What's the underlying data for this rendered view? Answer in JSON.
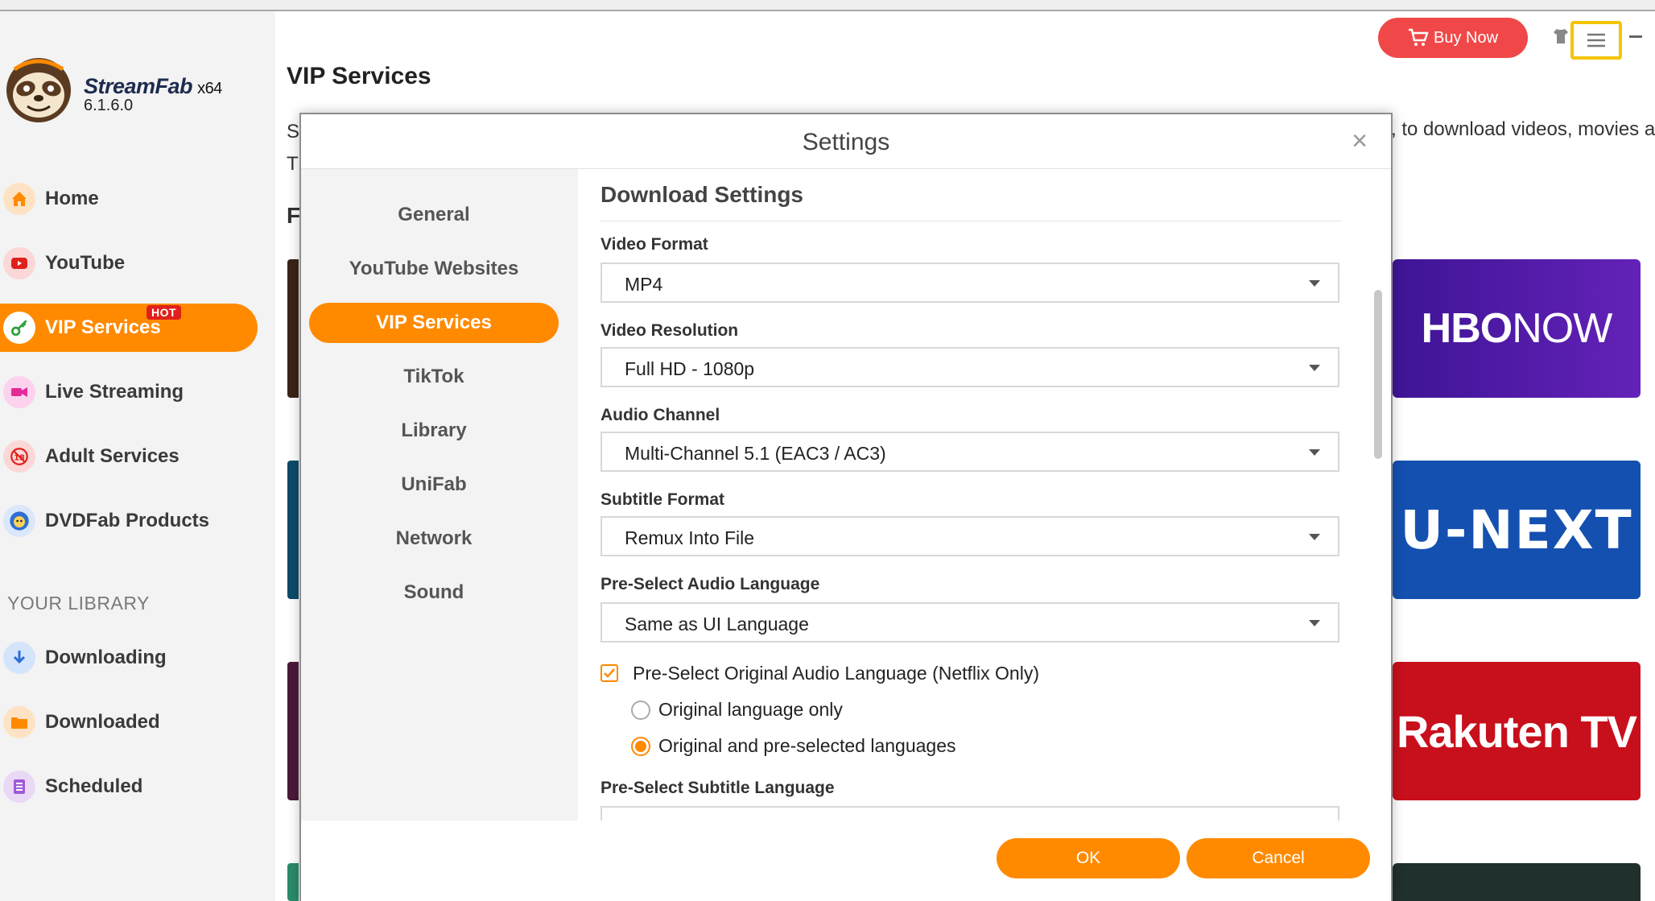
{
  "app": {
    "brand": "StreamFab",
    "arch": "x64",
    "version": "6.1.6.0"
  },
  "sidebar": {
    "items": [
      {
        "label": "Home"
      },
      {
        "label": "YouTube"
      },
      {
        "label": "VIP Services",
        "badge": "HOT"
      },
      {
        "label": "Live Streaming"
      },
      {
        "label": "Adult Services"
      },
      {
        "label": "DVDFab Products"
      }
    ],
    "library_title": "YOUR LIBRARY",
    "library_items": [
      {
        "label": "Downloading"
      },
      {
        "label": "Downloaded"
      },
      {
        "label": "Scheduled"
      }
    ]
  },
  "header": {
    "page_title": "VIP Services",
    "buy_now": "Buy Now"
  },
  "background": {
    "line1": "S",
    "line2": "T",
    "line3": "F",
    "right_text": ", to download videos, movies a",
    "tiles": [
      {
        "title_a": "HBO",
        "title_b": "NOW"
      },
      {
        "title": "U-NEXT"
      },
      {
        "title": "Rakuten TV"
      }
    ]
  },
  "dialog": {
    "title": "Settings",
    "tabs": [
      {
        "label": "General"
      },
      {
        "label": "YouTube Websites"
      },
      {
        "label": "VIP Services"
      },
      {
        "label": "TikTok"
      },
      {
        "label": "Library"
      },
      {
        "label": "UniFab"
      },
      {
        "label": "Network"
      },
      {
        "label": "Sound"
      }
    ],
    "section_title": "Download Settings",
    "fields": [
      {
        "label": "Video Format",
        "value": "MP4"
      },
      {
        "label": "Video Resolution",
        "value": "Full HD - 1080p"
      },
      {
        "label": "Audio Channel",
        "value": "Multi-Channel 5.1 (EAC3 / AC3)"
      },
      {
        "label": "Subtitle Format",
        "value": "Remux Into File"
      },
      {
        "label": "Pre-Select Audio Language",
        "value": "Same as UI Language"
      }
    ],
    "checkbox_label": "Pre-Select Original Audio Language (Netflix Only)",
    "radio_options": [
      {
        "label": "Original language only"
      },
      {
        "label": "Original and pre-selected languages"
      }
    ],
    "subtitle_lang_label": "Pre-Select Subtitle Language",
    "ok_label": "OK",
    "cancel_label": "Cancel"
  },
  "colors": {
    "accent": "#ff8a00",
    "buy_button": "#f04848",
    "highlight": "#f5c400"
  }
}
